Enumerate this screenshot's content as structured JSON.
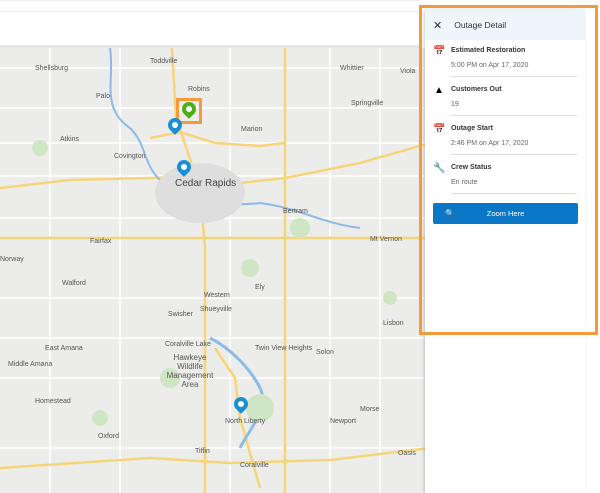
{
  "map": {
    "labels": [
      "Shellsburg",
      "Toddville",
      "Robins",
      "Whittier",
      "Viola",
      "Palo",
      "Springville",
      "Marion",
      "Covington",
      "Atkins",
      "Cedar Rapids",
      "Bertram",
      "Fairfax",
      "Mt Vernon",
      "Norway",
      "Walford",
      "Ely",
      "Western",
      "Swisher",
      "Shueyville",
      "Lisbon",
      "Solon",
      "Twin View Heights",
      "Coralville Lake",
      "Hawkeye Wildlife Management Area",
      "Middle Amana",
      "East Amana",
      "Homestead",
      "North Liberty",
      "Morse",
      "Newport",
      "Oxford",
      "Tiffin",
      "Oasis",
      "Coralville"
    ],
    "pins": [
      {
        "type": "outage",
        "color": "#4caf1a",
        "icon": "warning-icon"
      },
      {
        "type": "crew",
        "color": "#1a8fd6"
      },
      {
        "type": "location",
        "color": "#1a8fd6"
      },
      {
        "type": "location",
        "color": "#1a8fd6"
      }
    ],
    "highlight_color": "#f39a3c"
  },
  "panel": {
    "title": "Outage Detail",
    "close_icon": "close-icon",
    "fields": [
      {
        "icon": "calendar-check-icon",
        "label": "Estimated Restoration",
        "value": "5:00 PM on Apr 17, 2020"
      },
      {
        "icon": "warning-icon",
        "label": "Customers Out",
        "value": "19"
      },
      {
        "icon": "calendar-x-icon",
        "label": "Outage Start",
        "value": "2:46 PM on Apr 17, 2020"
      },
      {
        "icon": "wrench-icon",
        "label": "Crew Status",
        "value": "En route"
      }
    ],
    "button": "Zoom Here",
    "button_color": "#0a76c6"
  }
}
